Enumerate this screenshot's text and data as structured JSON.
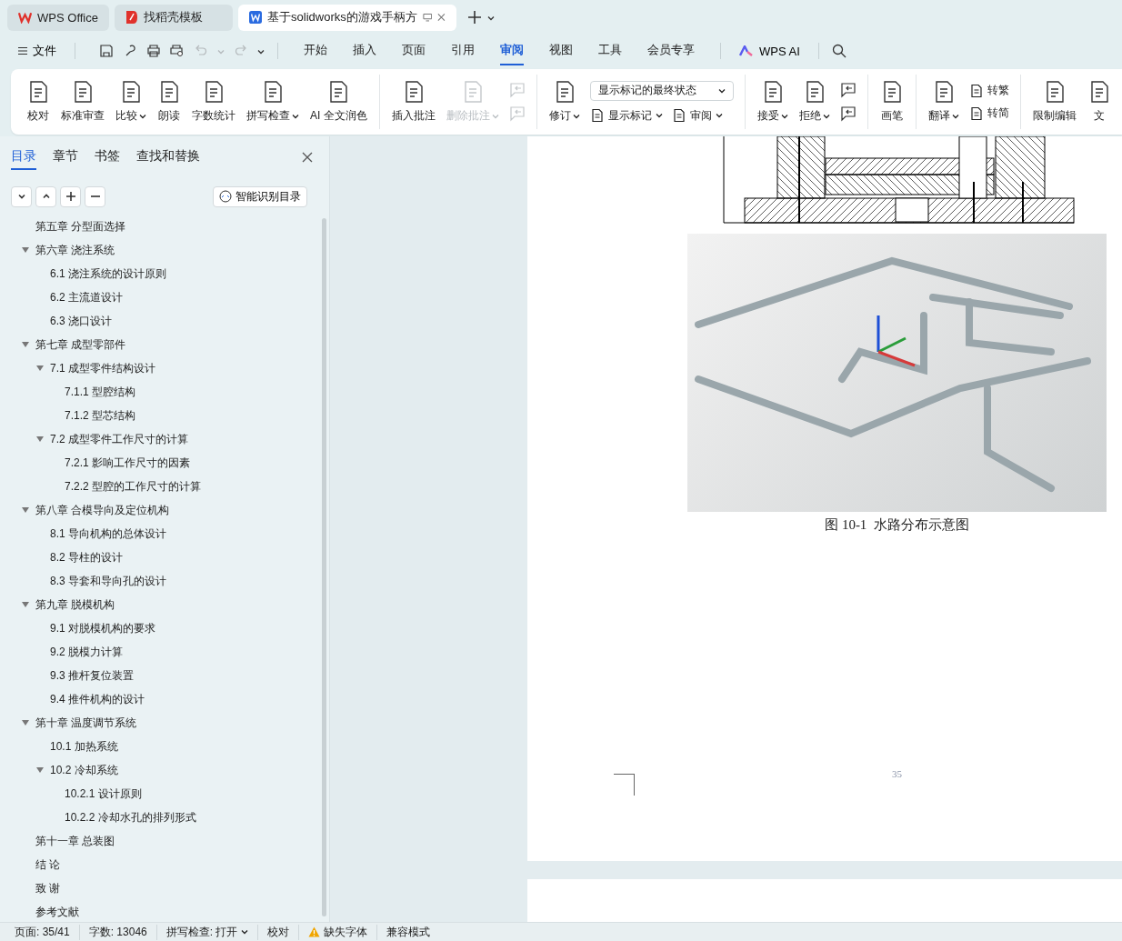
{
  "title_tabs": [
    {
      "label": "WPS Office",
      "kind": "wps",
      "selected": false
    },
    {
      "label": "找稻壳模板",
      "kind": "docer",
      "selected": false
    },
    {
      "label": "基于solidworks的游戏手柄方",
      "kind": "doc",
      "selected": true
    }
  ],
  "menu": {
    "file": "文件",
    "tabs": [
      {
        "label": "开始",
        "selected": false
      },
      {
        "label": "插入",
        "selected": false
      },
      {
        "label": "页面",
        "selected": false
      },
      {
        "label": "引用",
        "selected": false
      },
      {
        "label": "审阅",
        "selected": true
      },
      {
        "label": "视图",
        "selected": false
      },
      {
        "label": "工具",
        "selected": false
      },
      {
        "label": "会员专享",
        "selected": false
      }
    ],
    "ai": "WPS AI"
  },
  "ribbon": {
    "groups": [
      {
        "items": [
          {
            "kind": "large",
            "label": "校对",
            "dropdown": false,
            "disabled": false
          },
          {
            "kind": "large",
            "label": "标准审查",
            "dropdown": false,
            "disabled": false
          },
          {
            "kind": "large",
            "label": "比较",
            "dropdown": true,
            "disabled": false
          },
          {
            "kind": "large",
            "label": "朗读",
            "dropdown": false,
            "disabled": false
          },
          {
            "kind": "large",
            "label": "字数统计",
            "dropdown": false,
            "disabled": false
          },
          {
            "kind": "large",
            "label": "拼写检查",
            "dropdown": true,
            "disabled": false
          },
          {
            "kind": "large",
            "label": "AI 全文润色",
            "dropdown": false,
            "disabled": false
          }
        ]
      },
      {
        "items": [
          {
            "kind": "large",
            "label": "插入批注",
            "dropdown": false,
            "disabled": false
          },
          {
            "kind": "large",
            "label": "删除批注",
            "dropdown": true,
            "disabled": true
          },
          {
            "kind": "column",
            "rows": [
              [
                {
                  "kind": "icon",
                  "disabled": true
                }
              ],
              [
                {
                  "kind": "icon",
                  "disabled": true
                }
              ]
            ]
          }
        ]
      },
      {
        "items": [
          {
            "kind": "large",
            "label": "修订",
            "dropdown": true,
            "disabled": false
          },
          {
            "kind": "column",
            "rows": [
              [
                {
                  "kind": "select",
                  "label": "显示标记的最终状态"
                }
              ],
              [
                {
                  "kind": "small",
                  "label": "显示标记",
                  "dropdown": true,
                  "disabled": false
                },
                {
                  "kind": "small",
                  "label": "审阅",
                  "dropdown": true,
                  "disabled": false
                }
              ]
            ]
          }
        ]
      },
      {
        "items": [
          {
            "kind": "large",
            "label": "接受",
            "dropdown": true,
            "disabled": false
          },
          {
            "kind": "large",
            "label": "拒绝",
            "dropdown": true,
            "disabled": false
          },
          {
            "kind": "column",
            "rows": [
              [
                {
                  "kind": "icon",
                  "disabled": false
                }
              ],
              [
                {
                  "kind": "icon",
                  "disabled": false
                }
              ]
            ]
          }
        ]
      },
      {
        "items": [
          {
            "kind": "large",
            "label": "画笔",
            "dropdown": false,
            "disabled": false
          }
        ]
      },
      {
        "items": [
          {
            "kind": "large",
            "label": "翻译",
            "dropdown": true,
            "disabled": false
          },
          {
            "kind": "column",
            "rows": [
              [
                {
                  "kind": "small",
                  "label": "转繁",
                  "dropdown": false,
                  "disabled": false
                }
              ],
              [
                {
                  "kind": "small",
                  "label": "转简",
                  "dropdown": false,
                  "disabled": false
                }
              ]
            ]
          }
        ]
      },
      {
        "items": [
          {
            "kind": "large",
            "label": "限制编辑",
            "dropdown": false,
            "disabled": false
          },
          {
            "kind": "large",
            "label": "文",
            "dropdown": false,
            "disabled": false
          }
        ]
      }
    ]
  },
  "sidebar": {
    "tabs": [
      {
        "label": "目录",
        "selected": true
      },
      {
        "label": "章节",
        "selected": false
      },
      {
        "label": "书签",
        "selected": false
      },
      {
        "label": "查找和替换",
        "selected": false
      }
    ],
    "smart_button": "智能识别目录",
    "toc": [
      {
        "label": "第五章  分型面选择"
      },
      {
        "label": "第六章  浇注系统",
        "expanded": true,
        "children": [
          {
            "label": "6.1  浇注系统的设计原则"
          },
          {
            "label": "6.2  主流道设计"
          },
          {
            "label": "6.3  浇口设计"
          }
        ]
      },
      {
        "label": "第七章  成型零部件",
        "expanded": true,
        "children": [
          {
            "label": "7.1  成型零件结构设计",
            "expanded": true,
            "children": [
              {
                "label": "7.1.1  型腔结构"
              },
              {
                "label": "7.1.2  型芯结构"
              }
            ]
          },
          {
            "label": "7.2  成型零件工作尺寸的计算",
            "expanded": true,
            "children": [
              {
                "label": "7.2.1  影响工作尺寸的因素"
              },
              {
                "label": "7.2.2  型腔的工作尺寸的计算"
              }
            ]
          }
        ]
      },
      {
        "label": "第八章  合模导向及定位机构",
        "expanded": true,
        "children": [
          {
            "label": "8.1  导向机构的总体设计"
          },
          {
            "label": "8.2  导柱的设计"
          },
          {
            "label": "8.3  导套和导向孔的设计"
          }
        ]
      },
      {
        "label": "第九章  脱模机构",
        "expanded": true,
        "children": [
          {
            "label": "9.1  对脱模机构的要求"
          },
          {
            "label": "9.2  脱模力计算"
          },
          {
            "label": "9.3  推杆复位装置"
          },
          {
            "label": "9.4  推件机构的设计"
          }
        ]
      },
      {
        "label": "第十章  温度调节系统",
        "expanded": true,
        "children": [
          {
            "label": "10.1  加热系统"
          },
          {
            "label": "10.2  冷却系统",
            "expanded": true,
            "children": [
              {
                "label": "10.2.1  设计原则"
              },
              {
                "label": "10.2.2  冷却水孔的排列形式"
              }
            ]
          }
        ]
      },
      {
        "label": "第十一章  总装图"
      },
      {
        "label": "结  论"
      },
      {
        "label": "致  谢"
      },
      {
        "label": "参考文献"
      }
    ]
  },
  "document": {
    "caption": "图 10-1  水路分布示意图",
    "page_number": "35"
  },
  "status_bar": [
    {
      "kind": "text",
      "label": "页面: 35/41"
    },
    {
      "kind": "text",
      "label": "字数: 13046"
    },
    {
      "kind": "dropdown",
      "label": "拼写检查: 打开"
    },
    {
      "kind": "text",
      "label": "校对"
    },
    {
      "kind": "warning",
      "label": "缺失字体"
    },
    {
      "kind": "text",
      "label": "兼容模式"
    }
  ]
}
